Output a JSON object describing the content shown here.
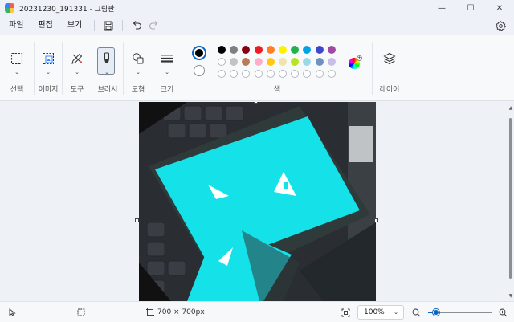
{
  "window": {
    "title": "20231230_191331 - 그림판",
    "minimize": "—",
    "maximize": "☐",
    "close": "✕"
  },
  "menu": {
    "file": "파일",
    "edit": "편집",
    "view": "보기"
  },
  "ribbon": {
    "groups": {
      "select": "선택",
      "image": "이미지",
      "tools": "도구",
      "brush": "브러시",
      "shapes": "도형",
      "size": "크기",
      "colors": "색",
      "layers": "레이어"
    },
    "primary_color": "#000000",
    "secondary_color": "#ffffff",
    "palette_row1": [
      "#000000",
      "#7f7f7f",
      "#880015",
      "#ed1c24",
      "#ff7f27",
      "#fff200",
      "#22b14c",
      "#00a2e8",
      "#3f48cc",
      "#a349a4"
    ],
    "palette_row2": [
      "#ffffff",
      "#c3c3c3",
      "#b97a57",
      "#ffaec9",
      "#ffc90e",
      "#efe4b0",
      "#b5e61d",
      "#99d9ea",
      "#7092be",
      "#c8bfe7"
    ],
    "custom_colors_count": "10"
  },
  "canvas": {
    "image_description_colors": {
      "background": "#202327",
      "screen": "#14e1e8",
      "phone_frame": "#2f3a3a"
    }
  },
  "status": {
    "canvas_size": "700 × 700px",
    "zoom": "100%",
    "zoom_out": "−",
    "zoom_in": "+"
  }
}
